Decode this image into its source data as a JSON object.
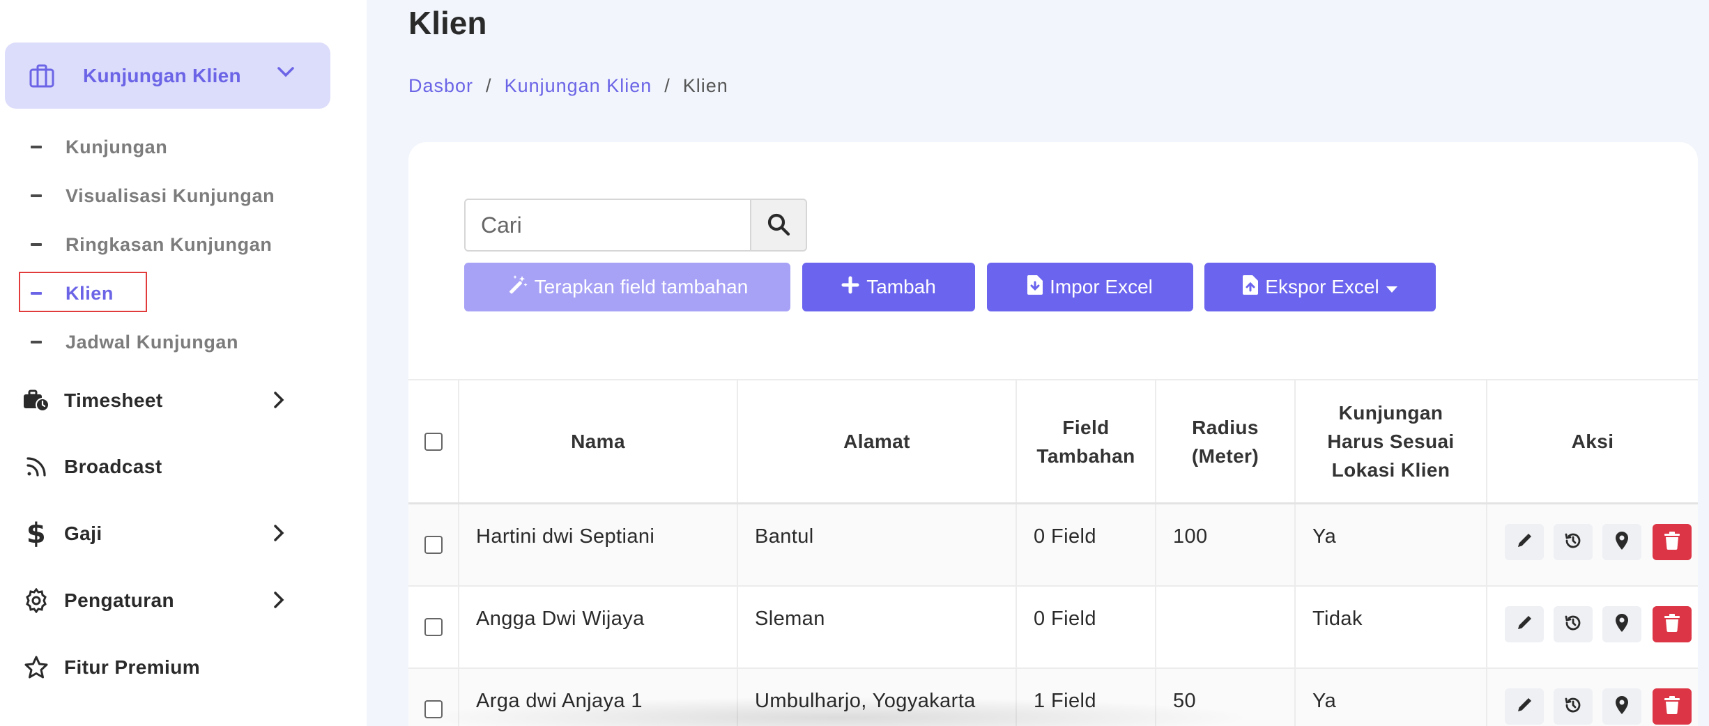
{
  "sidebar": {
    "group": {
      "label": "Kunjungan Klien",
      "icon": "briefcase-icon"
    },
    "sub_items": [
      {
        "label": "Kunjungan",
        "active": false
      },
      {
        "label": "Visualisasi Kunjungan",
        "active": false
      },
      {
        "label": "Ringkasan Kunjungan",
        "active": false
      },
      {
        "label": "Klien",
        "active": true
      },
      {
        "label": "Jadwal Kunjungan",
        "active": false
      }
    ],
    "main_items": [
      {
        "label": "Timesheet",
        "icon": "timesheet-icon",
        "has_children": true
      },
      {
        "label": "Broadcast",
        "icon": "rss-icon",
        "has_children": false
      },
      {
        "label": "Gaji",
        "icon": "dollar-icon",
        "has_children": true
      },
      {
        "label": "Pengaturan",
        "icon": "gear-icon",
        "has_children": true
      },
      {
        "label": "Fitur Premium",
        "icon": "star-icon",
        "has_children": false
      }
    ]
  },
  "page": {
    "title": "Klien",
    "breadcrumb": [
      "Dasbor",
      "Kunjungan Klien",
      "Klien"
    ]
  },
  "search": {
    "placeholder": "Cari",
    "value": ""
  },
  "buttons": {
    "apply_fields": "Terapkan field tambahan",
    "add": "Tambah",
    "import": "Impor Excel",
    "export": "Ekspor Excel"
  },
  "table": {
    "headers": {
      "nama": "Nama",
      "alamat": "Alamat",
      "field_1": "Field",
      "field_2": "Tambahan",
      "radius_1": "Radius",
      "radius_2": "(Meter)",
      "lokasi_1": "Kunjungan",
      "lokasi_2": "Harus Sesuai",
      "lokasi_3": "Lokasi Klien",
      "aksi": "Aksi"
    },
    "rows": [
      {
        "nama": "Hartini dwi Septiani",
        "alamat": "Bantul",
        "field": "0 Field",
        "radius": "100",
        "lokasi": "Ya"
      },
      {
        "nama": "Angga Dwi Wijaya",
        "alamat": "Sleman",
        "field": "0 Field",
        "radius": "",
        "lokasi": "Tidak"
      },
      {
        "nama": "Arga dwi Anjaya 1",
        "alamat": "Umbulharjo, Yogyakarta",
        "field": "1 Field",
        "radius": "50",
        "lokasi": "Ya"
      }
    ]
  },
  "colors": {
    "accent": "#6b64ee",
    "accent_light": "#a7a2f6",
    "danger": "#dc3545",
    "sidebar_active_bg": "#dcdcfb"
  }
}
